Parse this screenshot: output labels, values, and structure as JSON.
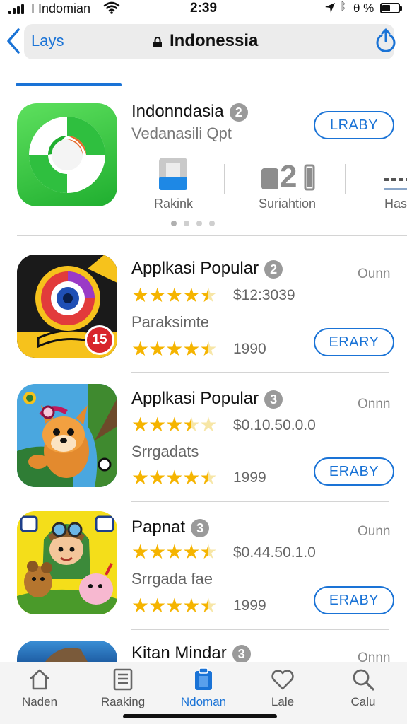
{
  "status_bar": {
    "carrier": "I Indomian",
    "time": "2:39",
    "battery_text": "θ %"
  },
  "nav": {
    "back_label": "Lays",
    "title": "Indonessia",
    "accent_color": "#1a73d6"
  },
  "featured": {
    "title": "Indonndasia",
    "badge": "2",
    "subtitle": "Vedanasili Qpt",
    "button": "LRABY",
    "info": [
      {
        "label": "Rakink",
        "icon": "chart-bar-icon"
      },
      {
        "label": "Suriahtion",
        "value": "2",
        "icon": "age-rating-icon"
      },
      {
        "label": "Has",
        "icon": "more-icon"
      }
    ],
    "page_dots": 4,
    "active_dot": 0
  },
  "apps": [
    {
      "title": "Applkasi Popular",
      "badge": "2",
      "side": "Ounn",
      "rating": 4.5,
      "price": "$12:3039",
      "subtitle": "Paraksimte",
      "rating2": 4.5,
      "count": "1990",
      "button": "ERARY",
      "icon_badge": "15"
    },
    {
      "title": "Applkasi Popular",
      "badge": "3",
      "side": "Onnn",
      "rating": 3.5,
      "price": "$0.10.50.0.0",
      "subtitle": "Srrgadats",
      "rating2": 4.5,
      "count": "1999",
      "button": "ERABY"
    },
    {
      "title": "Papnat",
      "badge": "3",
      "side": "Ounn",
      "rating": 4.5,
      "price": "$0.44.50.1.0",
      "subtitle": "Srrgada fae",
      "rating2": 4.5,
      "count": "1999",
      "button": "ERABY"
    },
    {
      "title": "Kitan Mindar",
      "badge": "3",
      "side": "Onnn"
    }
  ],
  "tabbar": {
    "tabs": [
      {
        "label": "Naden",
        "icon": "home-icon"
      },
      {
        "label": "Raaking",
        "icon": "list-icon"
      },
      {
        "label": "Ndoman",
        "icon": "clipboard-icon"
      },
      {
        "label": "Lale",
        "icon": "heart-icon"
      },
      {
        "label": "Calu",
        "icon": "search-icon"
      }
    ],
    "active_index": 2
  }
}
